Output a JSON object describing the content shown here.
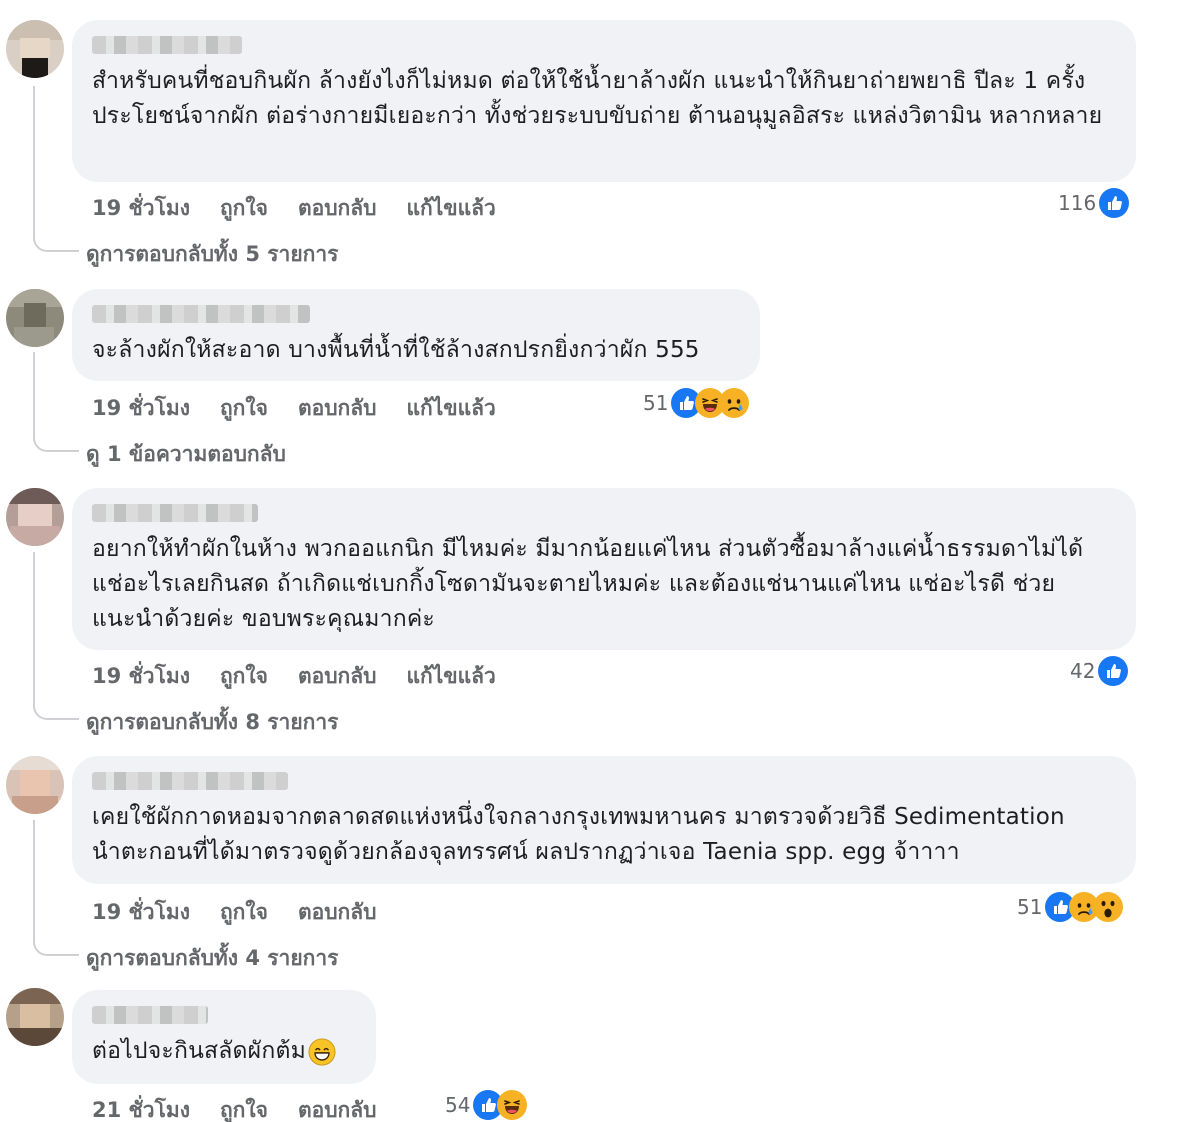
{
  "comments": [
    {
      "text": "สำหรับคนที่ชอบกินผัก ล้างยังไงก็ไม่หมด ต่อให้ใช้น้ำยาล้างผัก แนะนำให้กินยาถ่ายพยาธิ ปีละ 1 ครั้ง ประโยชน์จากผัก ต่อร่างกายมีเยอะกว่า ทั้งช่วยระบบขับถ่าย ต้านอนุมูลอิสระ แหล่งวิตามิน หลากหลาย",
      "time": "19 ชั่วโมง",
      "like_label": "ถูกใจ",
      "reply_label": "ตอบกลับ",
      "edited_label": "แก้ไขแล้ว",
      "reaction_count": "116",
      "reaction_icons": [
        "like-icon"
      ],
      "replies_link": "ดูการตอบกลับทั้ง 5 รายการ"
    },
    {
      "text": "จะล้างผักให้สะอาด บางพื้นที่น้ำที่ใช้ล้างสกปรกยิ่งกว่าผัก 555",
      "time": "19 ชั่วโมง",
      "like_label": "ถูกใจ",
      "reply_label": "ตอบกลับ",
      "edited_label": "แก้ไขแล้ว",
      "reaction_count": "51",
      "reaction_icons": [
        "like-icon",
        "haha-icon",
        "sad-icon"
      ],
      "replies_link": "ดู 1 ข้อความตอบกลับ"
    },
    {
      "text": "อยากให้ทำผักในห้าง พวกออแกนิก มีไหมค่ะ มีมากน้อยแค่ไหน ส่วนตัวซื้อมาล้างแค่น้ำธรรมดาไม่ได้แช่อะไรเลยกินสด ถ้าเกิดแช่เบกกิ้งโซดามันจะตายไหมค่ะ และต้องแช่นานแค่ไหน แช่อะไรดี ช่วยแนะนำด้วยค่ะ ขอบพระคุณมากค่ะ",
      "time": "19 ชั่วโมง",
      "like_label": "ถูกใจ",
      "reply_label": "ตอบกลับ",
      "edited_label": "แก้ไขแล้ว",
      "reaction_count": "42",
      "reaction_icons": [
        "like-icon"
      ],
      "replies_link": "ดูการตอบกลับทั้ง 8 รายการ"
    },
    {
      "text_line1": "เคยใช้ผักกาดหอมจากตลาดสดแห่งหนึ่งใจกลางกรุงเทพมหานคร มาตรวจด้วยวิธี Sedimentation",
      "text_line2": "นำตะกอนที่ได้มาตรวจดูด้วยกล้องจุลทรรศน์ ผลปรากฏว่าเจอ Taenia spp. egg จ้าาาา",
      "time": "19 ชั่วโมง",
      "like_label": "ถูกใจ",
      "reply_label": "ตอบกลับ",
      "reaction_count": "51",
      "reaction_icons": [
        "like-icon",
        "sad-icon",
        "wow-icon"
      ],
      "replies_link": "ดูการตอบกลับทั้ง 4 รายการ"
    },
    {
      "text": "ต่อไปจะกินสลัดผักต้ม",
      "text_emoji": "grinning-emoji",
      "time": "21 ชั่วโมง",
      "like_label": "ถูกใจ",
      "reply_label": "ตอบกลับ",
      "reaction_count": "54",
      "reaction_icons": [
        "like-icon",
        "haha-icon"
      ]
    }
  ],
  "colors": {
    "bubble": "#f0f2f5",
    "meta_text": "#65676b",
    "like_blue": "#1877f2",
    "emoji_yellow": "#f7b125"
  }
}
